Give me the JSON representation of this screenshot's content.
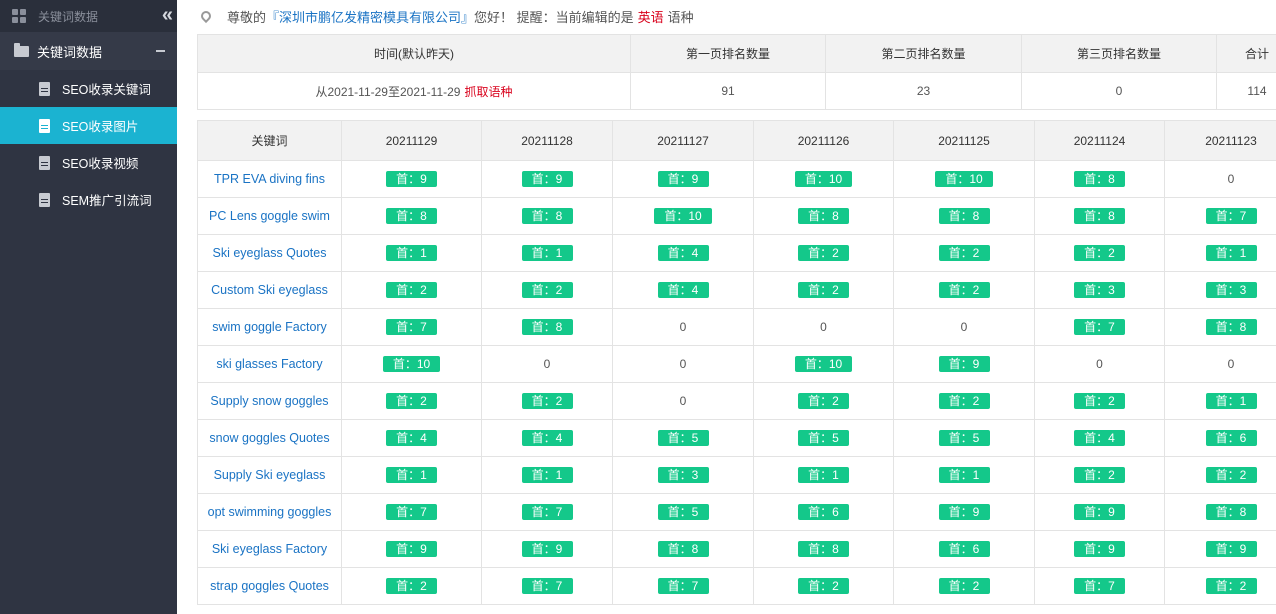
{
  "sidebar": {
    "header_title": "关键词数据",
    "collapse_icon": "double-chevron-left-icon",
    "group_label": "关键词数据",
    "items": [
      {
        "label": "SEO收录关键词",
        "active": false
      },
      {
        "label": "SEO收录图片",
        "active": true
      },
      {
        "label": "SEO收录视频",
        "active": false
      },
      {
        "label": "SEM推广引流词",
        "active": false
      }
    ]
  },
  "notice": {
    "prefix": "尊敬的",
    "company": "『深圳市鹏亿发精密模具有限公司』",
    "greeting": "您好！ 提醒：当前编辑的是",
    "language": "英语",
    "suffix": "语种"
  },
  "summary": {
    "headers": [
      "时间(默认昨天)",
      "第一页排名数量",
      "第二页排名数量",
      "第三页排名数量",
      "合计"
    ],
    "date_range": "从2021-11-29至2021-11-29",
    "fetch_link": "抓取语种",
    "values": [
      "91",
      "23",
      "0",
      "114"
    ]
  },
  "ranks": {
    "headers": [
      "关键词",
      "20211129",
      "20211128",
      "20211127",
      "20211126",
      "20211125",
      "20211124",
      "20211123"
    ],
    "badge_prefix": "首：",
    "rows": [
      {
        "keyword": "TPR EVA diving fins",
        "cells": [
          9,
          9,
          9,
          10,
          10,
          8,
          0
        ]
      },
      {
        "keyword": "PC Lens goggle swim",
        "cells": [
          8,
          8,
          10,
          8,
          8,
          8,
          7
        ]
      },
      {
        "keyword": "Ski eyeglass Quotes",
        "cells": [
          1,
          1,
          4,
          2,
          2,
          2,
          1
        ]
      },
      {
        "keyword": "Custom Ski eyeglass",
        "cells": [
          2,
          2,
          4,
          2,
          2,
          3,
          3
        ]
      },
      {
        "keyword": "swim goggle Factory",
        "cells": [
          7,
          8,
          0,
          0,
          0,
          7,
          8
        ]
      },
      {
        "keyword": "ski glasses Factory",
        "cells": [
          10,
          0,
          0,
          10,
          9,
          0,
          0
        ]
      },
      {
        "keyword": "Supply snow goggles",
        "cells": [
          2,
          2,
          0,
          2,
          2,
          2,
          1
        ]
      },
      {
        "keyword": "snow goggles Quotes",
        "cells": [
          4,
          4,
          5,
          5,
          5,
          4,
          6
        ]
      },
      {
        "keyword": "Supply Ski eyeglass",
        "cells": [
          1,
          1,
          3,
          1,
          1,
          2,
          2
        ]
      },
      {
        "keyword": "opt swimming goggles",
        "cells": [
          7,
          7,
          5,
          6,
          9,
          9,
          8
        ]
      },
      {
        "keyword": "Ski eyeglass Factory",
        "cells": [
          9,
          9,
          8,
          8,
          6,
          9,
          9
        ]
      },
      {
        "keyword": "strap goggles Quotes",
        "cells": [
          2,
          7,
          7,
          2,
          2,
          7,
          2
        ]
      }
    ]
  },
  "colors": {
    "sidebar_bg": "#2f3442",
    "active": "#1bb3d1",
    "badge": "#14c88a",
    "link": "#1a73c4",
    "alert": "#d9001b"
  }
}
